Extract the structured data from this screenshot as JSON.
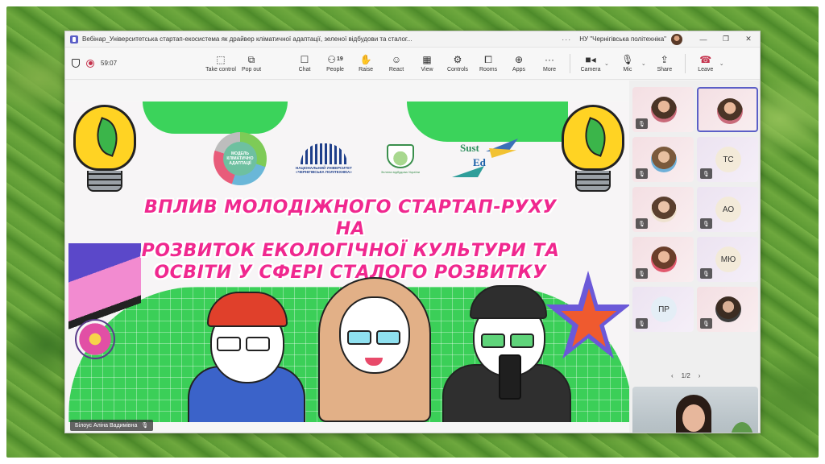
{
  "window": {
    "title": "Вебінар_Університетська стартап-екосистема як драйвер кліматичної адаптації, зеленої відбудови та сталог...",
    "org": "НУ \"Чернігівська політехніка\"",
    "minimize": "—",
    "maximize": "❐",
    "close": "✕"
  },
  "toolbar": {
    "timer": "59:07",
    "buttons": [
      {
        "label": "Take control",
        "icon": "take-control-icon"
      },
      {
        "label": "Pop out",
        "icon": "pop-out-icon"
      },
      {
        "label": "Chat",
        "icon": "chat-icon"
      },
      {
        "label": "People",
        "icon": "people-icon",
        "count": "19"
      },
      {
        "label": "Raise",
        "icon": "raise-hand-icon"
      },
      {
        "label": "React",
        "icon": "react-icon"
      },
      {
        "label": "View",
        "icon": "view-icon"
      },
      {
        "label": "Controls",
        "icon": "controls-icon"
      },
      {
        "label": "Rooms",
        "icon": "rooms-icon"
      },
      {
        "label": "Apps",
        "icon": "apps-icon"
      },
      {
        "label": "More",
        "icon": "more-icon"
      },
      {
        "label": "Camera",
        "icon": "camera-icon"
      },
      {
        "label": "Mic",
        "icon": "mic-off-icon"
      },
      {
        "label": "Share",
        "icon": "share-icon"
      },
      {
        "label": "Leave",
        "icon": "leave-icon"
      }
    ]
  },
  "slide": {
    "title_lines": [
      "ВПЛИВ МОЛОДІЖНОГО СТАРТАП-РУХУ НА",
      "РОЗВИТОК ЕКОЛОГІЧНОЇ КУЛЬТУРИ ТА",
      "ОСВІТИ У СФЕРІ СТАЛОГО РОЗВИТКУ"
    ],
    "logo1_text": "МОДЕЛЬ КЛІМАТИЧНО АДАПТАЦІЇ",
    "logo2_line1": "НАЦІОНАЛЬНИЙ УНІВЕРСИТЕТ",
    "logo2_line2": "«ЧЕРНІГІВСЬКА ПОЛІТЕХНІКА»",
    "logo3_text": "Зелена відбудова України",
    "logo4_line1": "Sust",
    "logo4_line2": "Ed"
  },
  "presenter_name": "Білоус Аліна Вадимівна",
  "participants": {
    "tiles": [
      {
        "type": "photo"
      },
      {
        "type": "photo"
      },
      {
        "type": "photo"
      },
      {
        "type": "initials",
        "initials": "ТС"
      },
      {
        "type": "photo"
      },
      {
        "type": "initials",
        "initials": "АО"
      },
      {
        "type": "photo"
      },
      {
        "type": "initials",
        "initials": "МЮ"
      },
      {
        "type": "initials",
        "initials": "ПР"
      },
      {
        "type": "photo"
      }
    ],
    "page": "1/2"
  },
  "colors": {
    "accent": "#5b5fc7",
    "slide_title": "#f0288f",
    "slide_green": "#3bd35b",
    "leave": "#c4314b"
  }
}
